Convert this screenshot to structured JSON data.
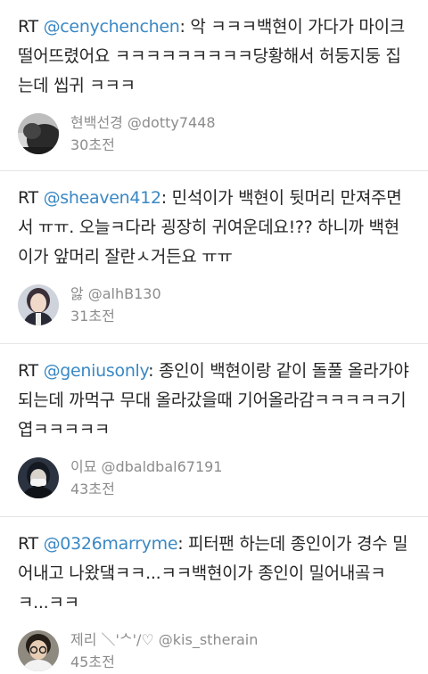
{
  "tweets": [
    {
      "prefix": "RT ",
      "mention": "@cenychenchen",
      "body": ": 악 ㅋㅋㅋ백현이 가다가 마이크 떨어뜨렸어요 ㅋㅋㅋㅋㅋㅋㅋㅋㅋ당황해서 허둥지둥 집는데 씹귀 ㅋㅋㅋ",
      "display_name": "현백선경",
      "handle": "@dotty7448",
      "time": "30초전",
      "avatar_icon": "user-avatar-dark-photo"
    },
    {
      "prefix": "RT ",
      "mention": "@sheaven412",
      "body": ": 민석이가 백현이 뒷머리 만져주면서 ㅠㅠ. 오늘ㅋ다라 굉장히 귀여운데요!?? 하니까 백현이가 앞머리 잘란ㅅ거든요 ㅠㅠ",
      "display_name": "앓",
      "handle": "@alhB130",
      "time": "31초전",
      "avatar_icon": "user-avatar-portrait-photo"
    },
    {
      "prefix": "RT ",
      "mention": "@geniusonly",
      "body": ": 종인이 백현이랑 같이 돌풀 올라가야되는데 까먹구 무대 올라갔을때 기어올라감ㅋㅋㅋㅋㅋ기엽ㅋㅋㅋㅋㅋ",
      "display_name": "이묘",
      "handle": "@dbaldbal67191",
      "time": "43초전",
      "avatar_icon": "user-avatar-masked-photo"
    },
    {
      "prefix": "RT ",
      "mention": "@0326marryme",
      "body": ": 피터팬 하는데 종인이가 경수 밀어내고 나왔댘ㅋㅋ...ㅋㅋ백현이가 종인이 밀어내곸ㅋㅋ...ㅋㅋ",
      "display_name": "제리 ＼'ᄉ'/♡",
      "handle": "@kis_stherain",
      "time": "45초전",
      "avatar_icon": "user-avatar-glasses-photo"
    }
  ],
  "colors": {
    "mention": "#3a88c4",
    "meta_text": "#8c8c8c",
    "body_text": "#262626",
    "divider": "#e6e6e6"
  }
}
